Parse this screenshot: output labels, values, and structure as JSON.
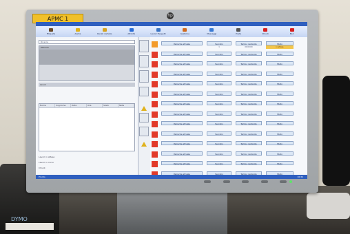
{
  "monitor_sticker": "APMC 1",
  "window_title": "APMC 1",
  "toolbar": [
    {
      "label": "Etiqueta",
      "icon": "dog-icon",
      "color": "#6b4b2a"
    },
    {
      "label": "Alerta",
      "icon": "alert-icon",
      "color": "#e0b21c"
    },
    {
      "label": "Recall cartelle",
      "icon": "folder-icon",
      "color": "#d6a322"
    },
    {
      "label": "Attività",
      "icon": "calendar-icon",
      "color": "#2b6dd6"
    },
    {
      "label": "Lavori Eseguiti",
      "icon": "doc-icon",
      "color": "#3a74c4"
    },
    {
      "label": "Gestione",
      "icon": "tools-icon",
      "color": "#d16a1d"
    },
    {
      "label": "Messaggi",
      "icon": "chat-icon",
      "color": "#3a7bd4"
    },
    {
      "label": "Posta",
      "icon": "mail-icon",
      "color": "#555"
    },
    {
      "label": "Chiudi",
      "icon": "stop-icon",
      "color": "#d72020"
    },
    {
      "label": "Esci",
      "icon": "exit-icon",
      "color": "#d72020"
    }
  ],
  "left_panel": {
    "search_placeholder": "Ricerca",
    "list_header": "Pazienti",
    "strip_label": "Lavori",
    "grid_headers": [
      "Nome",
      "Cognome",
      "Data",
      "Ora",
      "Stato",
      "Note"
    ],
    "bottom_lines": [
      "Lavori in attesa",
      "Lavori in corso",
      "Chiudi"
    ]
  },
  "rows": [
    {
      "patient": "Paziente attuale",
      "service": "Servizio",
      "time": "Tempo restante",
      "state": "Stato",
      "service_val": "1",
      "time_val": "00:00:00",
      "state_val": "in attesa",
      "highlight": true
    },
    {
      "patient": "Paziente attuale",
      "service": "Servizio",
      "time": "Tempo restante",
      "state": "Stato",
      "service_val": "",
      "time_val": "",
      "state_val": "",
      "highlight": false
    },
    {
      "patient": "Paziente attuale",
      "service": "Servizio",
      "time": "Tempo restante",
      "state": "Stato",
      "service_val": "",
      "time_val": "",
      "state_val": "",
      "highlight": false
    },
    {
      "patient": "Paziente attuale",
      "service": "Servizio",
      "time": "Tempo restante",
      "state": "Stato",
      "service_val": "",
      "time_val": "",
      "state_val": "",
      "highlight": false
    },
    {
      "patient": "Paziente attuale",
      "service": "Servizio",
      "time": "Tempo restante",
      "state": "Stato",
      "service_val": "",
      "time_val": "",
      "state_val": "",
      "highlight": false
    },
    {
      "patient": "Paziente attuale",
      "service": "Servizio",
      "time": "Tempo restante",
      "state": "Stato",
      "service_val": "",
      "time_val": "",
      "state_val": "",
      "highlight": false
    },
    {
      "patient": "Paziente attuale",
      "service": "Servizio",
      "time": "Tempo restante",
      "state": "Stato",
      "service_val": "",
      "time_val": "",
      "state_val": "",
      "highlight": false
    },
    {
      "patient": "Paziente attuale",
      "service": "Servizio",
      "time": "Tempo restante",
      "state": "Stato",
      "service_val": "",
      "time_val": "",
      "state_val": "",
      "highlight": false
    },
    {
      "patient": "Paziente attuale",
      "service": "Servizio",
      "time": "Tempo restante",
      "state": "Stato",
      "service_val": "",
      "time_val": "",
      "state_val": "",
      "highlight": false
    },
    {
      "patient": "Paziente attuale",
      "service": "Servizio",
      "time": "Tempo restante",
      "state": "Stato",
      "service_val": "",
      "time_val": "",
      "state_val": "",
      "highlight": false
    },
    {
      "patient": "Paziente attuale",
      "service": "Servizio",
      "time": "Tempo restante",
      "state": "Stato",
      "service_val": "",
      "time_val": "",
      "state_val": "",
      "highlight": false
    },
    {
      "patient": "Paziente attuale",
      "service": "Servizio",
      "time": "Tempo restante",
      "state": "Stato",
      "service_val": "",
      "time_val": "",
      "state_val": "",
      "highlight": false
    },
    {
      "patient": "Paziente attuale",
      "service": "Servizio",
      "time": "Tempo restante",
      "state": "Stato",
      "service_val": "",
      "time_val": "",
      "state_val": "",
      "highlight": false
    },
    {
      "patient": "Paziente attuale",
      "service": "Servizio",
      "time": "Tempo restante",
      "state": "Stato",
      "service_val": "",
      "time_val": "",
      "state_val": "",
      "highlight": false
    }
  ],
  "status_bar": "Pronto",
  "clock": "16:32",
  "left_device_logo": "DYMO"
}
